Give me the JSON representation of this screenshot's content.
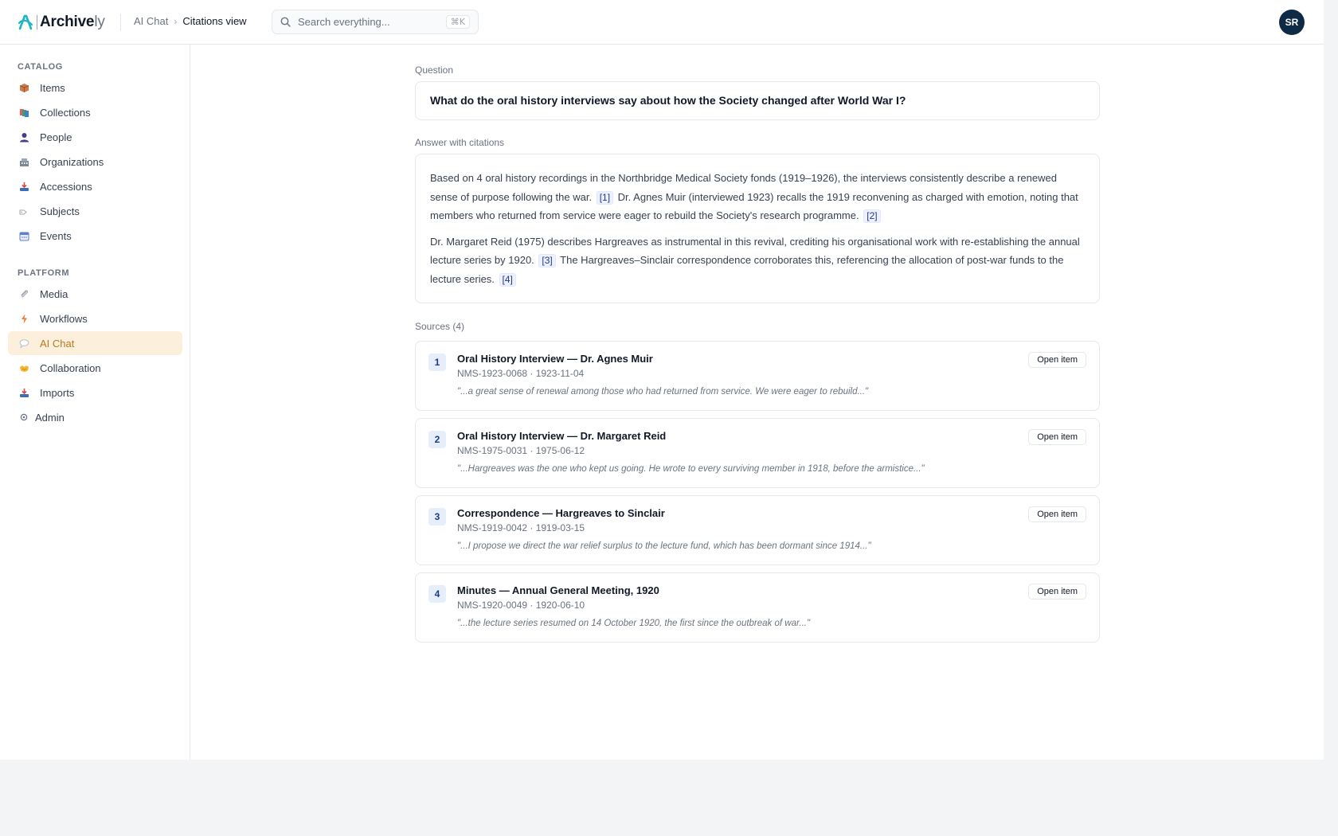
{
  "app": {
    "brand": "Archive",
    "brand_suffix": "ly",
    "avatar_initials": "SR",
    "accent": "#b7791f"
  },
  "breadcrumb": {
    "parent": "AI Chat",
    "separator": "›",
    "current": "Citations view"
  },
  "search": {
    "placeholder": "Search everything...",
    "shortcut": "⌘K"
  },
  "sidebar": {
    "catalog_label": "CATALOG",
    "platform_label": "PLATFORM",
    "catalog": [
      {
        "label": "Items",
        "icon": "box-icon"
      },
      {
        "label": "Collections",
        "icon": "collections-icon"
      },
      {
        "label": "People",
        "icon": "person-icon"
      },
      {
        "label": "Organizations",
        "icon": "building-icon"
      },
      {
        "label": "Accessions",
        "icon": "inbox-tray-icon"
      },
      {
        "label": "Subjects",
        "icon": "tag-icon"
      },
      {
        "label": "Events",
        "icon": "calendar-icon"
      }
    ],
    "platform": [
      {
        "label": "Media",
        "icon": "paperclip-icon"
      },
      {
        "label": "Workflows",
        "icon": "lightning-icon"
      },
      {
        "label": "AI Chat",
        "icon": "speech-bubble-icon",
        "active": true
      },
      {
        "label": "Collaboration",
        "icon": "handshake-icon"
      },
      {
        "label": "Imports",
        "icon": "inbox-tray-icon"
      },
      {
        "label": "Admin",
        "icon": "gear-icon"
      }
    ]
  },
  "main": {
    "question_label": "Question",
    "question": "What do the oral history interviews say about how the Society changed after World War I?",
    "answer_label": "Answer with citations",
    "answer": {
      "p1_a": "Based on 4 oral history recordings in the Northbridge Medical Society fonds (1919–1926), the interviews consistently describe a renewed sense of purpose following the war.",
      "c1": "[1]",
      "p1_b": "Dr. Agnes Muir (interviewed 1923) recalls the 1919 reconvening as charged with emotion, noting that members who returned from service were eager to rebuild the Society's research programme.",
      "c2": "[2]",
      "p2_a": "Dr. Margaret Reid (1975) describes Hargreaves as instrumental in this revival, crediting his organisational work with re-establishing the annual lecture series by 1920.",
      "c3": "[3]",
      "p2_b": "The Hargreaves–Sinclair correspondence corroborates this, referencing the allocation of post-war funds to the lecture series.",
      "c4": "[4]"
    },
    "sources_label": "Sources (4)",
    "open_label": "Open item",
    "sources": [
      {
        "num": "1",
        "title": "Oral History Interview — Dr. Agnes Muir",
        "meta": "NMS-1923-0068 · 1923-11-04",
        "quote": "\"...a great sense of renewal among those who had returned from service. We were eager to rebuild...\""
      },
      {
        "num": "2",
        "title": "Oral History Interview — Dr. Margaret Reid",
        "meta": "NMS-1975-0031 · 1975-06-12",
        "quote": "\"...Hargreaves was the one who kept us going. He wrote to every surviving member in 1918, before the armistice...\""
      },
      {
        "num": "3",
        "title": "Correspondence — Hargreaves to Sinclair",
        "meta": "NMS-1919-0042 · 1919-03-15",
        "quote": "\"...I propose we direct the war relief surplus to the lecture fund, which has been dormant since 1914...\""
      },
      {
        "num": "4",
        "title": "Minutes — Annual General Meeting, 1920",
        "meta": "NMS-1920-0049 · 1920-06-10",
        "quote": "\"...the lecture series resumed on 14 October 1920, the first since the outbreak of war...\""
      }
    ]
  }
}
